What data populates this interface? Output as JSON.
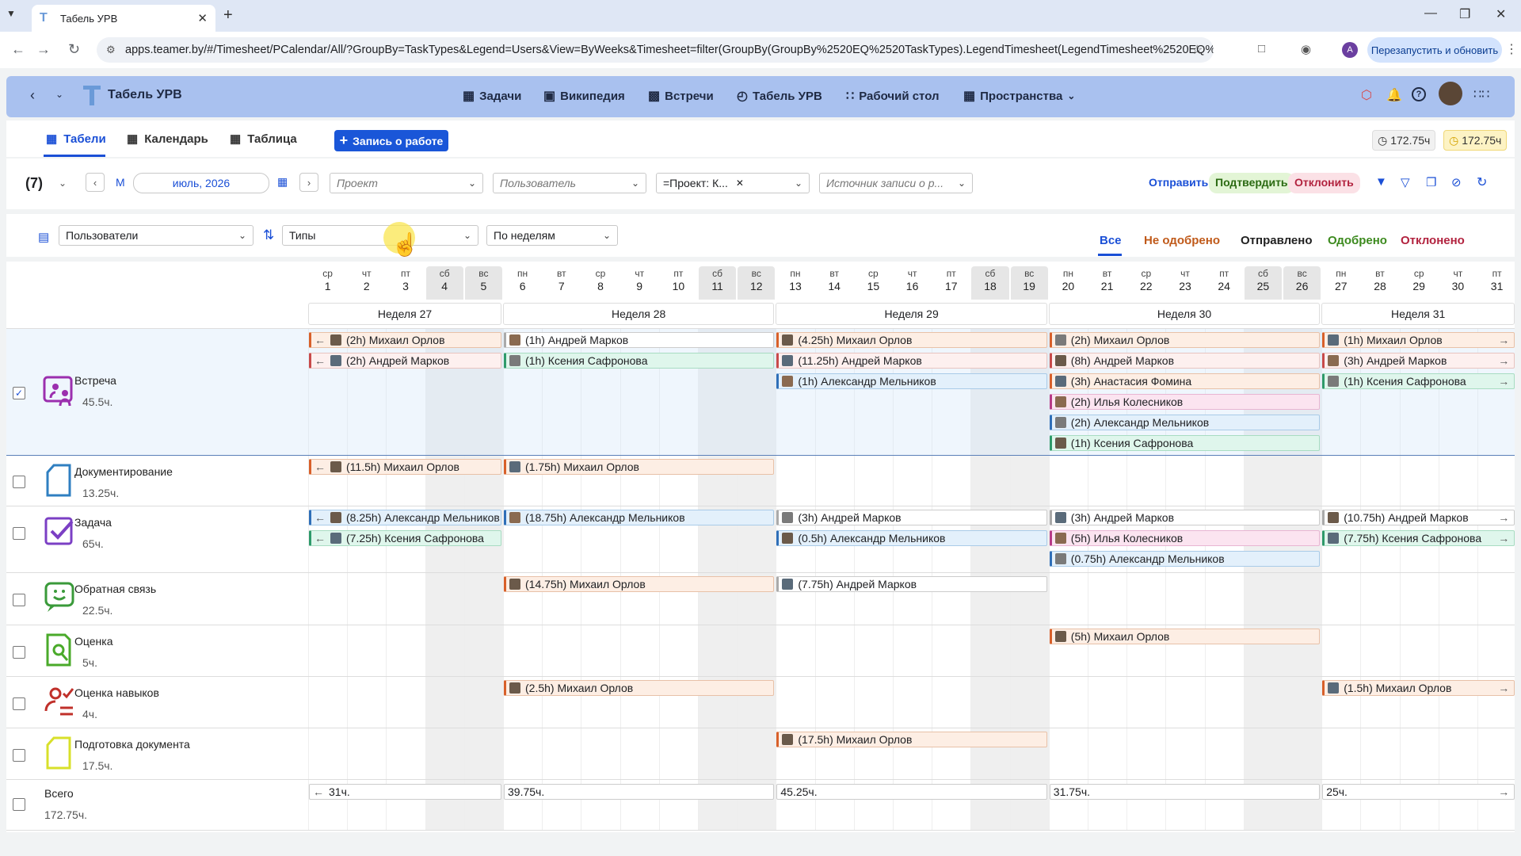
{
  "browser": {
    "tab_title": "Табель УРВ",
    "url": "apps.teamer.by/#/Timesheet/PCalendar/All/?GroupBy=TaskTypes&Legend=Users&View=ByWeeks&Timesheet=filter(GroupBy(GroupBy%2520EQ%2520TaskTypes).LegendTimesheet(LegendTimesheet%2520EQ%252...",
    "profile_initial": "A",
    "relaunch_label": "Перезапустить и обновить"
  },
  "header": {
    "app_title": "Табель УРВ",
    "nav": [
      "Задачи",
      "Википедия",
      "Встречи",
      "Табель УРВ",
      "Рабочий стол",
      "Пространства"
    ]
  },
  "subnav": {
    "tabs": [
      "Табели",
      "Календарь",
      "Таблица"
    ],
    "add_button": "Запись о работе",
    "hours_1": "172.75ч",
    "hours_2": "172.75ч"
  },
  "filters": {
    "count": "(7)",
    "period_mode": "М",
    "period_value": "июль, 2026",
    "project_placeholder": "Проект",
    "user_placeholder": "Пользователь",
    "project_filter": "=Проект: К...",
    "source_placeholder": "Источник записи о р...",
    "send": "Отправить",
    "confirm": "Подтвердить",
    "reject": "Отклонить"
  },
  "grouping": {
    "legend": "Пользователи",
    "group_by": "Типы",
    "view": "По неделям",
    "status_tabs": [
      "Все",
      "Не одобрено",
      "Отправлено",
      "Одобрено",
      "Отклонено"
    ]
  },
  "days": [
    {
      "dow": "ср",
      "d": "1"
    },
    {
      "dow": "чт",
      "d": "2"
    },
    {
      "dow": "пт",
      "d": "3"
    },
    {
      "dow": "сб",
      "d": "4"
    },
    {
      "dow": "вс",
      "d": "5"
    },
    {
      "dow": "пн",
      "d": "6"
    },
    {
      "dow": "вт",
      "d": "7"
    },
    {
      "dow": "ср",
      "d": "8"
    },
    {
      "dow": "чт",
      "d": "9"
    },
    {
      "dow": "пт",
      "d": "10"
    },
    {
      "dow": "сб",
      "d": "11"
    },
    {
      "dow": "вс",
      "d": "12"
    },
    {
      "dow": "пн",
      "d": "13"
    },
    {
      "dow": "вт",
      "d": "14"
    },
    {
      "dow": "ср",
      "d": "15"
    },
    {
      "dow": "чт",
      "d": "16"
    },
    {
      "dow": "пт",
      "d": "17"
    },
    {
      "dow": "сб",
      "d": "18"
    },
    {
      "dow": "вс",
      "d": "19"
    },
    {
      "dow": "пн",
      "d": "20"
    },
    {
      "dow": "вт",
      "d": "21"
    },
    {
      "dow": "ср",
      "d": "22"
    },
    {
      "dow": "чт",
      "d": "23"
    },
    {
      "dow": "пт",
      "d": "24"
    },
    {
      "dow": "сб",
      "d": "25"
    },
    {
      "dow": "вс",
      "d": "26"
    },
    {
      "dow": "пн",
      "d": "27"
    },
    {
      "dow": "вт",
      "d": "28"
    },
    {
      "dow": "ср",
      "d": "29"
    },
    {
      "dow": "чт",
      "d": "30"
    },
    {
      "dow": "пт",
      "d": "31"
    }
  ],
  "weeks": [
    "Неделя 27",
    "Неделя 28",
    "Неделя 29",
    "Неделя 30",
    "Неделя 31"
  ],
  "rows": [
    {
      "name": "Встреча",
      "hours": "45.5ч.",
      "checked": true,
      "icon": "meeting-icon",
      "entries": [
        {
          "wk": 0,
          "lane": 0,
          "text": "(2h) Михаил Орлов",
          "color": "c-orange",
          "left": true
        },
        {
          "wk": 0,
          "lane": 1,
          "text": "(2h) Андрей Марков",
          "color": "c-pinkl",
          "left": true
        },
        {
          "wk": 1,
          "lane": 0,
          "text": "(1h) Андрей Марков",
          "color": "c-white"
        },
        {
          "wk": 1,
          "lane": 1,
          "text": "(1h) Ксения Сафронова",
          "color": "c-green"
        },
        {
          "wk": 2,
          "lane": 0,
          "text": "(4.25h) Михаил Орлов",
          "color": "c-orange"
        },
        {
          "wk": 2,
          "lane": 1,
          "text": "(11.25h) Андрей Марков",
          "color": "c-pinkl"
        },
        {
          "wk": 2,
          "lane": 2,
          "text": "(1h) Александр Мельников",
          "color": "c-blue"
        },
        {
          "wk": 3,
          "lane": 0,
          "text": "(2h) Михаил Орлов",
          "color": "c-orange"
        },
        {
          "wk": 3,
          "lane": 1,
          "text": "(8h) Андрей Марков",
          "color": "c-pinkl"
        },
        {
          "wk": 3,
          "lane": 2,
          "text": "(3h) Анастасия Фомина",
          "color": "c-orange"
        },
        {
          "wk": 3,
          "lane": 3,
          "text": "(2h) Илья Колесников",
          "color": "c-pink"
        },
        {
          "wk": 3,
          "lane": 4,
          "text": "(2h) Александр Мельников",
          "color": "c-blue"
        },
        {
          "wk": 3,
          "lane": 5,
          "text": "(1h) Ксения Сафронова",
          "color": "c-green"
        },
        {
          "wk": 4,
          "lane": 0,
          "text": "(1h) Михаил Орлов",
          "color": "c-orange",
          "right": true
        },
        {
          "wk": 4,
          "lane": 1,
          "text": "(3h) Андрей Марков",
          "color": "c-pinkl",
          "right": true
        },
        {
          "wk": 4,
          "lane": 2,
          "text": "(1h) Ксения Сафронова",
          "color": "c-green",
          "right": true
        }
      ]
    },
    {
      "name": "Документирование",
      "hours": "13.25ч.",
      "checked": false,
      "icon": "document-icon",
      "entries": [
        {
          "wk": 0,
          "lane": 0,
          "text": "(11.5h) Михаил Орлов",
          "color": "c-orange",
          "left": true
        },
        {
          "wk": 1,
          "lane": 0,
          "text": "(1.75h) Михаил Орлов",
          "color": "c-orange"
        }
      ]
    },
    {
      "name": "Задача",
      "hours": "65ч.",
      "checked": false,
      "icon": "task-icon",
      "entries": [
        {
          "wk": 0,
          "lane": 0,
          "text": "(8.25h) Александр Мельников",
          "color": "c-blue",
          "left": true
        },
        {
          "wk": 0,
          "lane": 1,
          "text": "(7.25h) Ксения Сафронова",
          "color": "c-green",
          "left": true
        },
        {
          "wk": 1,
          "lane": 0,
          "text": "(18.75h) Александр Мельников",
          "color": "c-blue"
        },
        {
          "wk": 2,
          "lane": 0,
          "text": "(3h) Андрей Марков",
          "color": "c-white"
        },
        {
          "wk": 2,
          "lane": 1,
          "text": "(0.5h) Александр Мельников",
          "color": "c-blue"
        },
        {
          "wk": 3,
          "lane": 0,
          "text": "(3h) Андрей Марков",
          "color": "c-white"
        },
        {
          "wk": 3,
          "lane": 1,
          "text": "(5h) Илья Колесников",
          "color": "c-pink"
        },
        {
          "wk": 3,
          "lane": 2,
          "text": "(0.75h) Александр Мельников",
          "color": "c-blue"
        },
        {
          "wk": 4,
          "lane": 0,
          "text": "(10.75h) Андрей Марков",
          "color": "c-white",
          "right": true
        },
        {
          "wk": 4,
          "lane": 1,
          "text": "(7.75h) Ксения Сафронова",
          "color": "c-green",
          "right": true
        }
      ]
    },
    {
      "name": "Обратная связь",
      "hours": "22.5ч.",
      "checked": false,
      "icon": "feedback-icon",
      "entries": [
        {
          "wk": 1,
          "lane": 0,
          "text": "(14.75h) Михаил Орлов",
          "color": "c-orange"
        },
        {
          "wk": 2,
          "lane": 0,
          "text": "(7.75h) Андрей Марков",
          "color": "c-white"
        }
      ]
    },
    {
      "name": "Оценка",
      "hours": "5ч.",
      "checked": false,
      "icon": "evaluation-icon",
      "entries": [
        {
          "wk": 3,
          "lane": 0,
          "text": "(5h) Михаил Орлов",
          "color": "c-orange"
        }
      ]
    },
    {
      "name": "Оценка навыков",
      "hours": "4ч.",
      "checked": false,
      "icon": "skills-icon",
      "entries": [
        {
          "wk": 1,
          "lane": 0,
          "text": "(2.5h) Михаил Орлов",
          "color": "c-orange"
        },
        {
          "wk": 4,
          "lane": 0,
          "text": "(1.5h) Михаил Орлов",
          "color": "c-orange",
          "right": true
        }
      ]
    },
    {
      "name": "Подготовка документа",
      "hours": "17.5ч.",
      "checked": false,
      "icon": "doc-prep-icon",
      "entries": [
        {
          "wk": 2,
          "lane": 0,
          "text": "(17.5h) Михаил Орлов",
          "color": "c-orange"
        }
      ]
    }
  ],
  "total": {
    "name": "Всего",
    "hours": "172.75ч.",
    "weeks": [
      "31ч.",
      "39.75ч.",
      "45.25ч.",
      "31.75ч.",
      "25ч."
    ]
  }
}
